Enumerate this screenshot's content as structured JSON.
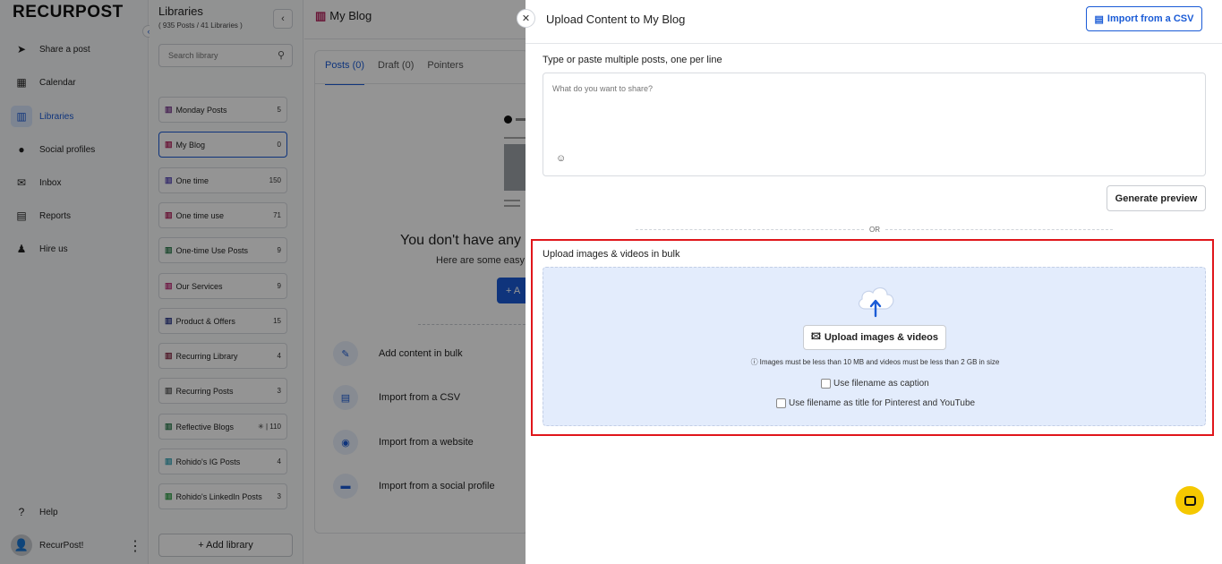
{
  "app": {
    "logo_text": "RECURPOST"
  },
  "sidebar": {
    "items": [
      {
        "label": "Share a post",
        "icon": "send-icon"
      },
      {
        "label": "Calendar",
        "icon": "calendar-icon"
      },
      {
        "label": "Libraries",
        "icon": "library-icon",
        "active": true
      },
      {
        "label": "Social profiles",
        "icon": "social-profile-icon"
      },
      {
        "label": "Inbox",
        "icon": "inbox-icon"
      },
      {
        "label": "Reports",
        "icon": "reports-icon"
      },
      {
        "label": "Hire us",
        "icon": "person-icon"
      }
    ],
    "help_label": "Help",
    "user_name": "RecurPost!"
  },
  "libraries": {
    "title": "Libraries",
    "subtitle": "( 935 Posts / 41 Libraries )",
    "search_placeholder": "Search library",
    "items": [
      {
        "name": "Monday Posts",
        "count": "5",
        "color": "#7a3b8f"
      },
      {
        "name": "My Blog",
        "count": "0",
        "color": "#b3245e",
        "active": true
      },
      {
        "name": "One time",
        "count": "150",
        "color": "#5b4ab8"
      },
      {
        "name": "One time use",
        "count": "71",
        "color": "#b3245e"
      },
      {
        "name": "One-time Use Posts",
        "count": "9",
        "color": "#2e7d4f"
      },
      {
        "name": "Our Services",
        "count": "9",
        "color": "#c0307a"
      },
      {
        "name": "Product & Offers",
        "count": "15",
        "color": "#2d3a8c"
      },
      {
        "name": "Recurring Library",
        "count": "4",
        "color": "#8a2f4a"
      },
      {
        "name": "Recurring Posts",
        "count": "3",
        "color": "#666666"
      },
      {
        "name": "Reflective Blogs",
        "count": "✳ | 110",
        "color": "#2e7d4f"
      },
      {
        "name": "Rohido's IG Posts",
        "count": "4",
        "color": "#3aa6b9"
      },
      {
        "name": "Rohido's LinkedIn Posts",
        "count": "3",
        "color": "#2e9e44"
      }
    ],
    "add_label": "+ Add library"
  },
  "main": {
    "title": "My Blog",
    "tabs": [
      {
        "label": "Posts (0)",
        "active": true
      },
      {
        "label": "Draft (0)"
      },
      {
        "label": "Pointers"
      }
    ],
    "empty_title": "You don't have any",
    "empty_sub": "Here are some easy",
    "empty_button": "+ A",
    "actions": [
      {
        "label": "Add content in bulk",
        "icon": "pencil-icon"
      },
      {
        "label": "Import from a CSV",
        "icon": "file-icon"
      },
      {
        "label": "Import from a website",
        "icon": "rss-icon"
      },
      {
        "label": "Import from a social profile",
        "icon": "chat-icon"
      }
    ]
  },
  "drawer": {
    "title": "Upload Content to My Blog",
    "csv_button": "Import from a CSV",
    "text_label": "Type or paste multiple posts, one per line",
    "text_placeholder": "What do you want to share?",
    "generate_button": "Generate preview",
    "or_text": "OR",
    "bulk_label": "Upload images & videos in bulk",
    "upload_button": "Upload images & videos",
    "upload_note": "Images must be less than 10 MB and videos must be less than 2 GB in size",
    "check_caption": "Use filename as caption",
    "check_title": "Use filename as title for Pinterest and YouTube"
  },
  "colors": {
    "accent": "#1a5bd6",
    "highlight_border": "#e0161b",
    "dropzone_bg": "#e3ecfc",
    "chat_button": "#f5c800"
  }
}
